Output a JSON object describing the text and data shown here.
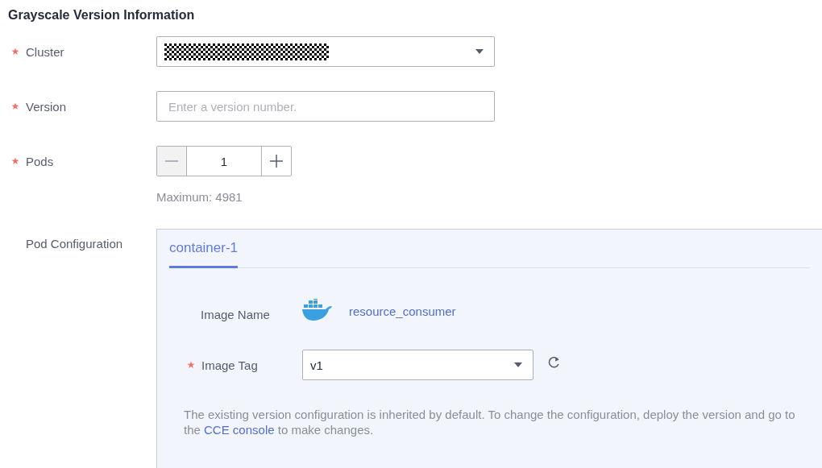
{
  "heading": "Grayscale Version Information",
  "fields": [
    {
      "kind": "select",
      "label": "Cluster",
      "required": true,
      "redacted": true
    },
    {
      "kind": "text",
      "label": "Version",
      "required": true,
      "placeholder": "Enter a version number."
    },
    {
      "kind": "stepper",
      "label": "Pods",
      "required": true,
      "value": "1",
      "minus_disabled": true,
      "hint": "Maximum: 4981"
    }
  ],
  "pod_configuration": {
    "label": "Pod Configuration",
    "tabs": [
      {
        "label": "container-1",
        "selected": true
      }
    ],
    "image_name": {
      "label": "Image Name",
      "value": "resource_consumer"
    },
    "image_tag": {
      "label": "Image Tag",
      "required": true,
      "value": "v1"
    },
    "note": {
      "before": "The existing version configuration is inherited by default. To change the configuration, deploy the version and go to the ",
      "link": "CCE console",
      "after": " to make changes."
    }
  }
}
